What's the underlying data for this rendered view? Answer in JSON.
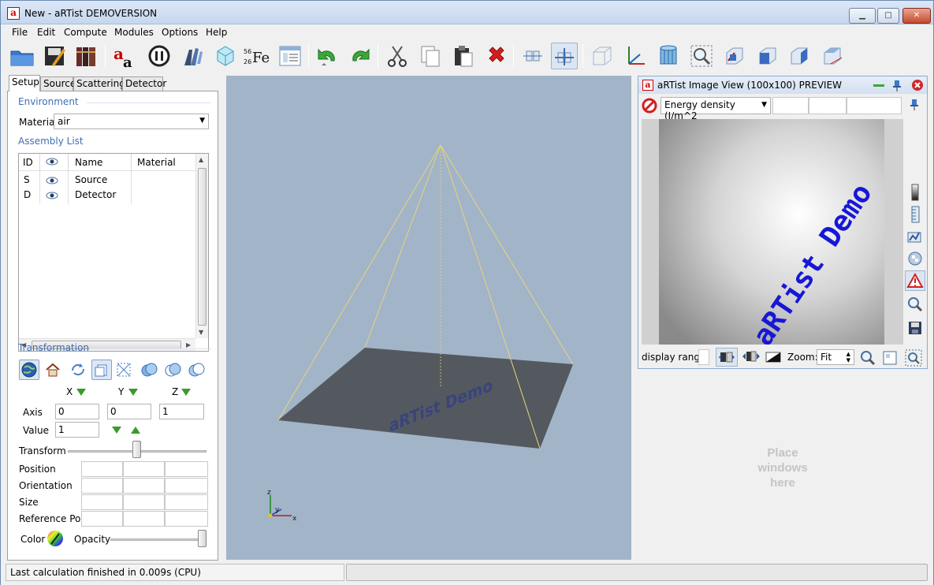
{
  "window": {
    "title": "New - aRTist DEMOVERSION",
    "logo_letter": "a",
    "btn_minimize": "▁",
    "btn_maximize": "□",
    "btn_close": "✕"
  },
  "menu": [
    "File",
    "Edit",
    "Compute",
    "Modules",
    "Options",
    "Help"
  ],
  "toolbar": {
    "icons": [
      "open-folder-icon",
      "save-icon",
      "library-icon",
      "artist-logo-icon",
      "pause-icon",
      "tool-icon",
      "crystal-icon",
      "element-icon",
      "script-icon",
      "undo-icon",
      "redo-icon",
      "cut-icon",
      "copy-icon",
      "paste-icon",
      "delete-icon",
      "align-icon",
      "snap-icon",
      "grid-box-icon",
      "axes-icon",
      "cylinder-icon",
      "zoom-fit-icon",
      "view-front-icon",
      "view-side-icon",
      "view-top-icon",
      "view-iso-icon"
    ],
    "element_label": "Fe",
    "element_mass": "56",
    "element_number": "26"
  },
  "tabs": [
    "Setup",
    "Source",
    "Scattering",
    "Detector"
  ],
  "environment": {
    "title": "Environment",
    "material_label": "Material",
    "material_value": "air"
  },
  "assembly": {
    "title": "Assembly List",
    "columns": [
      "ID",
      "Name",
      "Material"
    ],
    "rows": [
      {
        "id": "S",
        "name": "Source",
        "material": ""
      },
      {
        "id": "D",
        "name": "Detector",
        "material": ""
      }
    ]
  },
  "transformation": {
    "title": "Transformation",
    "axis_x": "X",
    "axis_y": "Y",
    "axis_z": "Z",
    "axis_label": "Axis",
    "axis_values": [
      "0",
      "0",
      "1"
    ],
    "value_label": "Value",
    "value_value": "1",
    "transform_label": "Transform",
    "position_label": "Position",
    "orientation_label": "Orientation",
    "size_label": "Size",
    "reference_label": "Reference Pos.",
    "color_label": "Color",
    "opacity_label": "Opacity"
  },
  "viewport": {
    "watermark": "aRTist Demo",
    "axis_z": "z",
    "axis_y": "y",
    "axis_x": "x",
    "frame_color": "#e8d47a",
    "detector_color": "#54595f"
  },
  "image_view": {
    "title": "aRTist Image View (100x100) PREVIEW",
    "quantity": "Energy density (J/m^2",
    "watermark": "aRTist Demo",
    "display_range_label": "display range",
    "zoom_label": "Zoom:",
    "zoom_value": "Fit"
  },
  "place_hint": [
    "Place",
    "windows",
    "here"
  ],
  "status": {
    "text": "Last calculation finished in 0.009s (CPU)"
  }
}
